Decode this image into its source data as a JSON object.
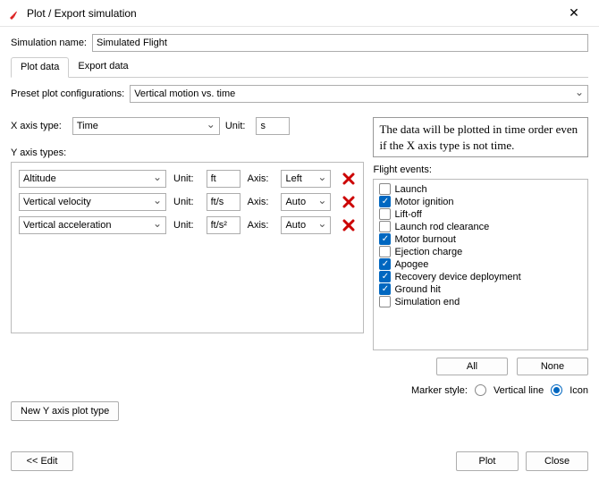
{
  "window": {
    "title": "Plot / Export simulation"
  },
  "sim_name_label": "Simulation name:",
  "sim_name_value": "Simulated Flight",
  "tabs": {
    "plot": "Plot data",
    "export": "Export data"
  },
  "preset": {
    "label": "Preset plot configurations:",
    "value": "Vertical motion vs. time"
  },
  "info_text": "The data will be plotted in time order even if the X axis type is not time.",
  "xaxis": {
    "label": "X axis type:",
    "value": "Time",
    "unit_label": "Unit:",
    "unit_value": "s"
  },
  "ylabel": "Y axis types:",
  "unit_label": "Unit:",
  "axis_label": "Axis:",
  "yrows": [
    {
      "type": "Altitude",
      "unit": "ft",
      "axis": "Left"
    },
    {
      "type": "Vertical velocity",
      "unit": "ft/s",
      "axis": "Auto"
    },
    {
      "type": "Vertical acceleration",
      "unit": "ft/s²",
      "axis": "Auto"
    }
  ],
  "flight": {
    "label": "Flight events:",
    "events": [
      {
        "label": "Launch",
        "checked": false
      },
      {
        "label": "Motor ignition",
        "checked": true
      },
      {
        "label": "Lift-off",
        "checked": false
      },
      {
        "label": "Launch rod clearance",
        "checked": false
      },
      {
        "label": "Motor burnout",
        "checked": true
      },
      {
        "label": "Ejection charge",
        "checked": false
      },
      {
        "label": "Apogee",
        "checked": true
      },
      {
        "label": "Recovery device deployment",
        "checked": true
      },
      {
        "label": "Ground hit",
        "checked": true
      },
      {
        "label": "Simulation end",
        "checked": false
      }
    ],
    "all": "All",
    "none": "None"
  },
  "marker": {
    "label": "Marker style:",
    "vertical": "Vertical line",
    "icon": "Icon"
  },
  "new_y": "New Y axis plot type",
  "footer": {
    "edit": "<< Edit",
    "plot": "Plot",
    "close": "Close"
  }
}
